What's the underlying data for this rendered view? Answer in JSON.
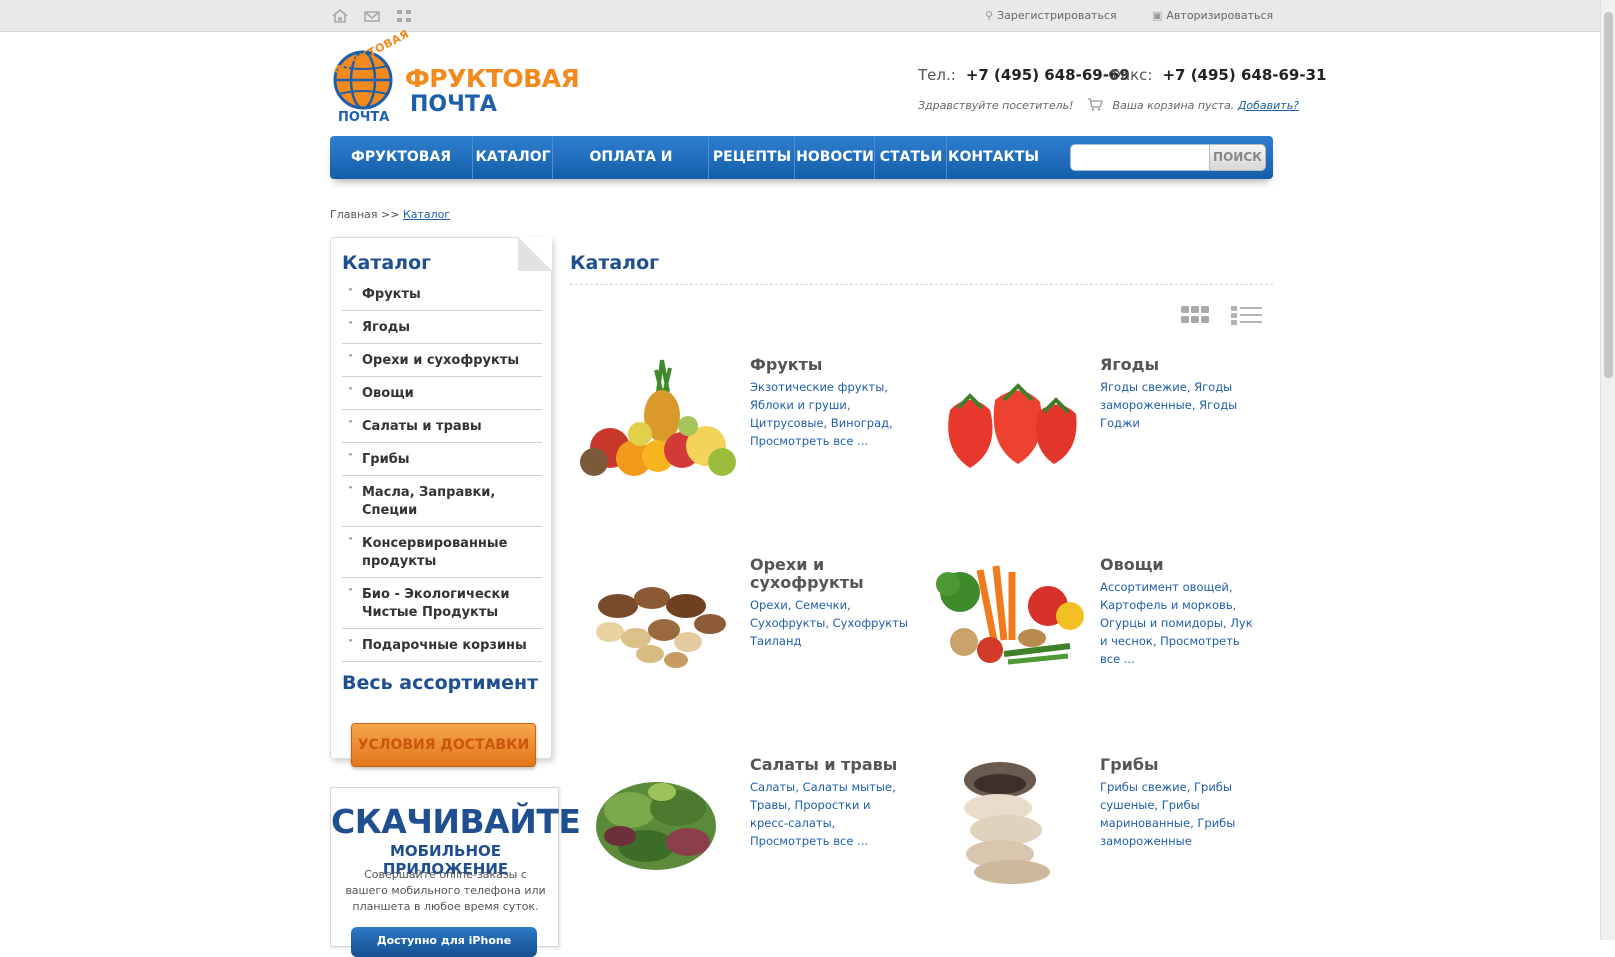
{
  "topbar": {
    "icons": [
      "home-icon",
      "mail-icon",
      "sitemap-icon"
    ],
    "register": "Зарегистрироваться",
    "login": "Авторизироваться"
  },
  "logo": {
    "arc_text": "ФРУКТОВАЯ",
    "bottom_text": "ПОЧТА",
    "title_line1": "ФРУКТОВАЯ",
    "title_line2": "ПОЧТА"
  },
  "contacts": {
    "phone_label": "Тел.:",
    "phone": "+7 (495) 648-69-69",
    "fax_label": "Факс:",
    "fax": "+7 (495) 648-69-31",
    "greeting": "Здравствуйте посетитель!",
    "cart_status": "Ваша корзина пуста.",
    "cart_add": "Добавить?"
  },
  "nav": {
    "items": [
      "ФРУКТОВАЯ ПОЧТА",
      "КАТАЛОГ",
      "ОПЛАТА И ДОСТАВКА",
      "РЕЦЕПТЫ",
      "НОВОСТИ",
      "СТАТЬИ",
      "КОНТАКТЫ"
    ],
    "search_placeholder": "",
    "search_button": "ПОИСК"
  },
  "breadcrumb": {
    "home": "Главная",
    "separator": ">>",
    "current": "Каталог"
  },
  "sidebar": {
    "title": "Каталог",
    "items": [
      "Фрукты",
      "Ягоды",
      "Орехи и сухофрукты",
      "Овощи",
      "Салаты и травы",
      "Грибы",
      "Масла, Заправки, Специи",
      "Консервированные продукты",
      "Био - Экологически Чистые Продукты",
      "Подарочные корзины"
    ],
    "all_assortment": "Весь ассортимент",
    "delivery_button": "УСЛОВИЯ ДОСТАВКИ"
  },
  "app_promo": {
    "headline": "СКАЧИВАЙТЕ",
    "subheadline": "МОБИЛЬНОЕ ПРИЛОЖЕНИЕ",
    "text": "Совершайте online-заказы с вашего мобильного телефона или планшета в любое время суток.",
    "button": "Доступно для iPhone"
  },
  "main": {
    "title": "Каталог",
    "categories": [
      {
        "name": "Фрукты",
        "links": "Экзотические фрукты, Яблоки и груши, Цитрусовые, Виноград, Просмотреть все ..."
      },
      {
        "name": "Ягоды",
        "links": "Ягоды свежие, Ягоды замороженные, Ягоды Годжи"
      },
      {
        "name": "Орехи и сухофрукты",
        "links": "Орехи, Семечки, Сухофрукты, Сухофрукты Таиланд"
      },
      {
        "name": "Овощи",
        "links": "Ассортимент овощей, Картофель и морковь, Огурцы и помидоры, Лук и чеснок, Просмотреть все ..."
      },
      {
        "name": "Салаты и травы",
        "links": "Салаты, Салаты мытые, Травы, Проростки и кресс-салаты, Просмотреть все ..."
      },
      {
        "name": "Грибы",
        "links": "Грибы свежие, Грибы сушеные, Грибы маринованные, Грибы замороженные"
      }
    ]
  },
  "colors": {
    "brand_orange": "#f28a1e",
    "brand_blue": "#1f5ea8",
    "nav_blue": "#145ea9"
  }
}
